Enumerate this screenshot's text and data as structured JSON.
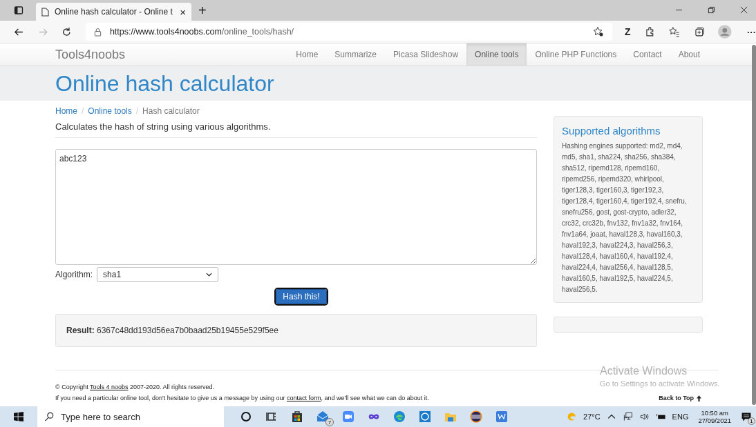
{
  "browser": {
    "tab_title": "Online hash calculator - Online t",
    "tab_close": "×",
    "new_tab": "+",
    "url_host": "https://www.tools4noobs.com",
    "url_path": "/online_tools/hash/",
    "profile_letter": "Z",
    "more": "···"
  },
  "navbar": {
    "brand": "Tools4noobs",
    "items": [
      {
        "label": "Home",
        "selected": false
      },
      {
        "label": "Summarize",
        "selected": false
      },
      {
        "label": "Picasa Slideshow",
        "selected": false
      },
      {
        "label": "Online tools",
        "selected": true
      },
      {
        "label": "Online PHP Functions",
        "selected": false
      },
      {
        "label": "Contact",
        "selected": false
      },
      {
        "label": "About",
        "selected": false
      }
    ]
  },
  "page_title": "Online hash calculator",
  "breadcrumb": [
    {
      "label": "Home",
      "link": true
    },
    {
      "label": "Online tools",
      "link": true
    },
    {
      "label": "Hash calculator",
      "link": false
    }
  ],
  "breadcrumb_separator": "/",
  "lead": "Calculates the hash of string using various algorithms.",
  "input": {
    "value": "abc123"
  },
  "algorithm": {
    "label": "Algorithm:",
    "value": "sha1"
  },
  "submit": "Hash this!",
  "result": {
    "label": "Result:",
    "value": "6367c48dd193d56ea7b0baad25b19455e529f5ee"
  },
  "sidebar": {
    "title": "Supported algorithms",
    "text": "Hashing engines supported: md2, md4, md5, sha1, sha224, sha256, sha384, sha512, ripemd128, ripemd160, ripemd256, ripemd320, whirlpool, tiger128,3, tiger160,3, tiger192,3, tiger128,4, tiger160,4, tiger192,4, snefru, snefru256, gost, gost-crypto, adler32, crc32, crc32b, fnv132, fnv1a32, fnv164, fnv1a64, joaat, haval128,3, haval160,3, haval192,3, haval224,3, haval256,3, haval128,4, haval160,4, haval192,4, haval224,4, haval256,4, haval128,5, haval160,5, haval192,5, haval224,5, haval256,5."
  },
  "footer": {
    "copyright_before": "© Copyright ",
    "copyright_link": "Tools 4 noobs",
    "copyright_after": " 2007-2020. All rights reserved.",
    "note_before": "If you need a particular online tool, don't hesitate to give us a message by using our ",
    "note_link": "contact form",
    "note_after": ", and we'll see what we can do about it.",
    "back_to_top": "Back to Top"
  },
  "activation": {
    "title": "Activate Windows",
    "subtitle": "Go to Settings to activate Windows."
  },
  "taskbar": {
    "search_placeholder": "Type here to search",
    "mail_badge": "7",
    "temperature": "27°C",
    "language": "ENG",
    "time": "10:50 am",
    "date": "27/09/2021",
    "notification_badge": "1"
  }
}
